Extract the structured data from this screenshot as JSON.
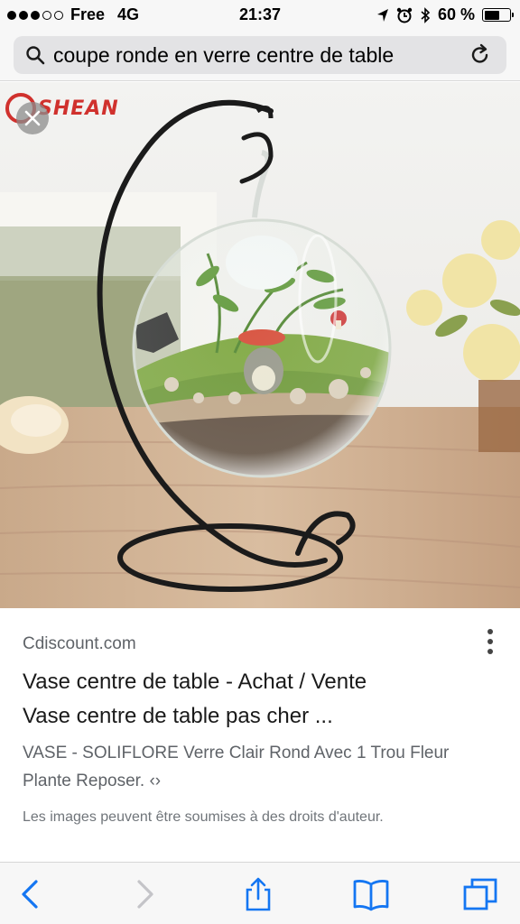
{
  "status_bar": {
    "carrier": "Free",
    "network": "4G",
    "time": "21:37",
    "battery_text": "60 %",
    "battery_level": 0.6
  },
  "address_bar": {
    "query": "coupe ronde en verre centre de table"
  },
  "image": {
    "logo_text": "SHEAN"
  },
  "result": {
    "source": "Cdiscount.com",
    "title_line1": "Vase centre de table - Achat / Vente",
    "title_line2": "Vase centre de table pas cher ...",
    "description_line1": "VASE - SOLIFLORE Verre Clair Rond Avec 1 Trou Fleur",
    "description_line2": "Plante Reposer. ‹›",
    "copyright": "Les images peuvent être soumises à des droits d'auteur."
  },
  "colors": {
    "accent": "#1a73e8",
    "ios_blue": "#1476f2",
    "logo_red": "#d0312d"
  },
  "icons": [
    "search-icon",
    "reload-icon",
    "close-icon",
    "more-icon",
    "back-icon",
    "forward-icon",
    "share-icon",
    "bookmarks-icon",
    "tabs-icon",
    "location-icon",
    "alarm-icon",
    "bluetooth-icon"
  ]
}
